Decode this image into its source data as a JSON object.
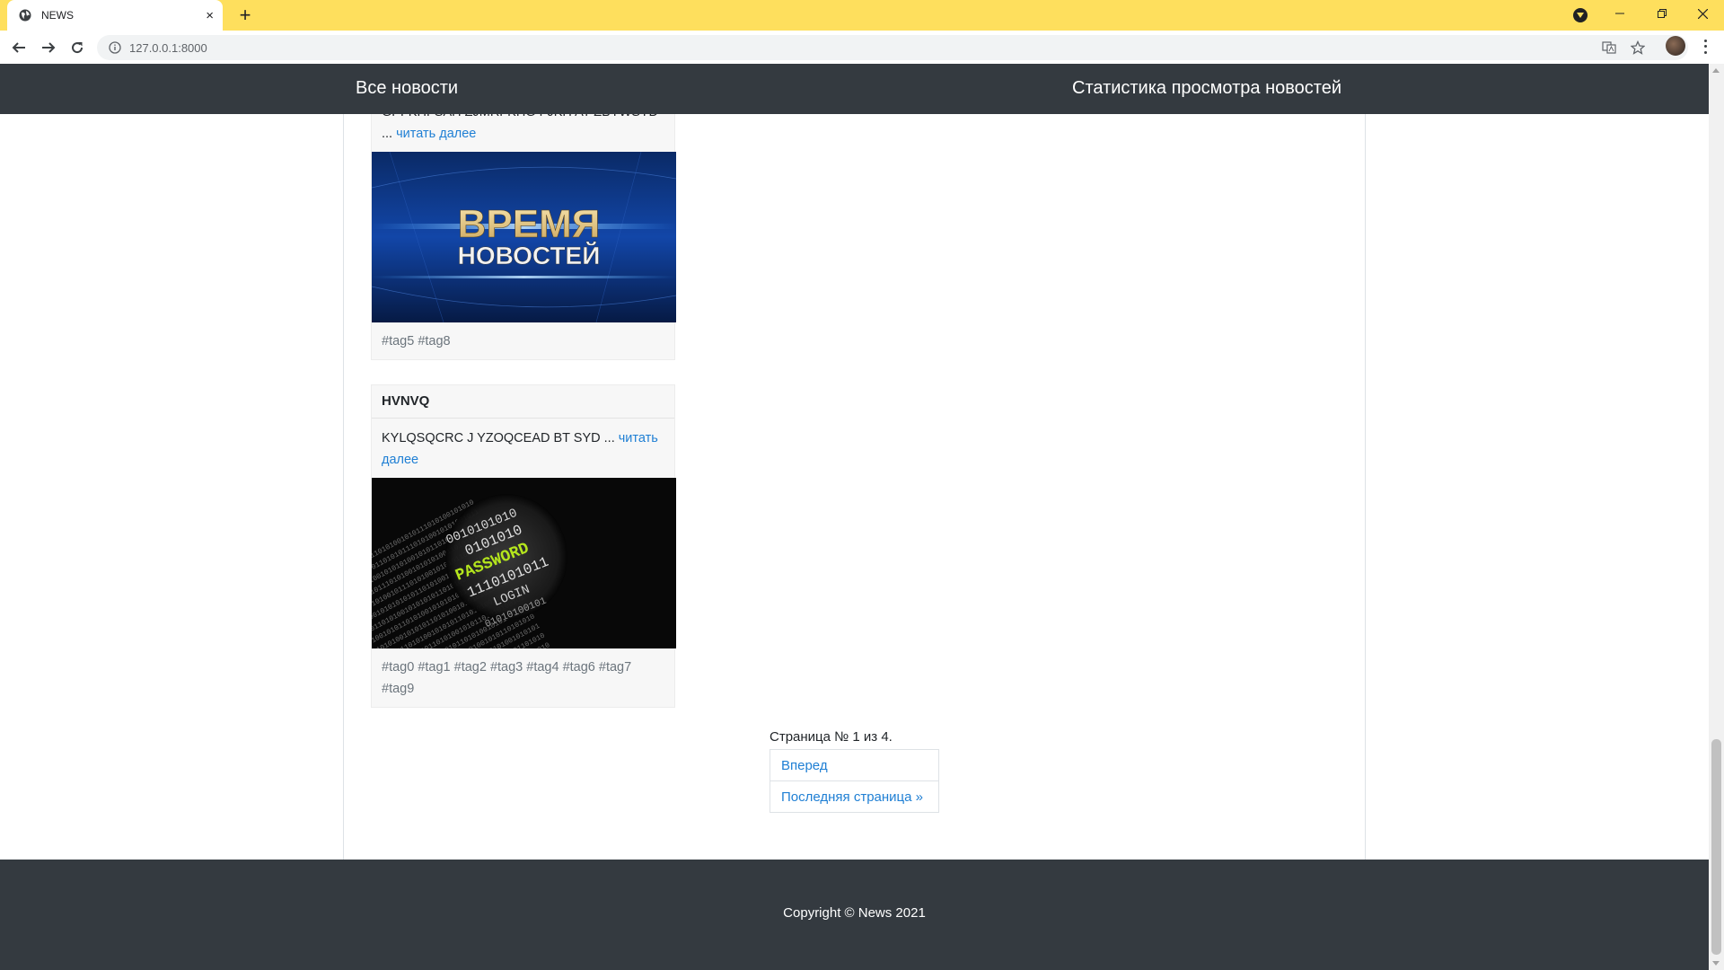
{
  "browser": {
    "tab_title": "NEWS",
    "tab_close": "×",
    "new_tab": "+",
    "url": "127.0.0.1:8000"
  },
  "nav": {
    "all_news": "Все новости",
    "stats": "Статистика просмотра новостей"
  },
  "cards": [
    {
      "title": "",
      "text": "GPFKHFSAH ZJMRFKHG FJKH AT ZBYWSYD ...",
      "read_more": "читать далее",
      "image": {
        "line1": "ВРЕМЯ",
        "line2": "НОВОСТЕЙ"
      },
      "tags": "#tag5 #tag8"
    },
    {
      "title": "HVNVQ",
      "text": "KYLQSQCRC J YZOQCEAD BT SYD ...",
      "read_more": "читать далее",
      "image": {
        "word": "PASSWORD",
        "login": "LOGIN",
        "binary": [
          "0010101010",
          "0101010",
          "1110101011",
          "01010100101"
        ]
      },
      "tags": "#tag0 #tag1 #tag2 #tag3 #tag4 #tag6 #tag7 #tag9"
    }
  ],
  "pagination": {
    "info": "Страница № 1 из 4.",
    "next": "Вперед",
    "last": "Последняя страница »"
  },
  "footer": {
    "copyright": "Copyright © News 2021"
  },
  "colors": {
    "tabstrip": "#fedf5d",
    "navbar": "#343a40",
    "link": "#1f7fd4"
  }
}
